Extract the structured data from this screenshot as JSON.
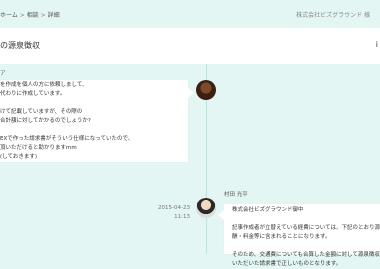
{
  "header": {
    "breadcrumb": [
      "ホーム",
      "相談",
      "詳細"
    ],
    "separator": ">",
    "company": "株式会社ビズグラウンド 様"
  },
  "title_card": {
    "title": "の源泉徴収",
    "action_glyph": "i"
  },
  "left_partial_label": "ア",
  "messages": [
    {
      "side": "left",
      "lines": [
        "を作成を個人の方に依頼しまして、",
        "代わりに作成しています。",
        "",
        "けて記載していますが、その際の",
        "合計額に対してかかるのでしょうか?",
        "",
        "EXで作った請求書がそういう仕様になっていたので、",
        "頂いただけると助かりますmm",
        "(しておきます)"
      ]
    },
    {
      "side": "right",
      "sender": "村田 光平",
      "date": "2015-04-23",
      "time": "11:13",
      "lines": [
        "株式会社ビズグラウンド御中",
        "",
        "記事作成者が立替えている経費については、下記のとおり源泉",
        "酬・料金等に含まれることになります。",
        "",
        "そのため、交通費についても合算した金額に対して源泉徴収",
        "いただいた請求書で正しいものとなります。"
      ]
    }
  ]
}
